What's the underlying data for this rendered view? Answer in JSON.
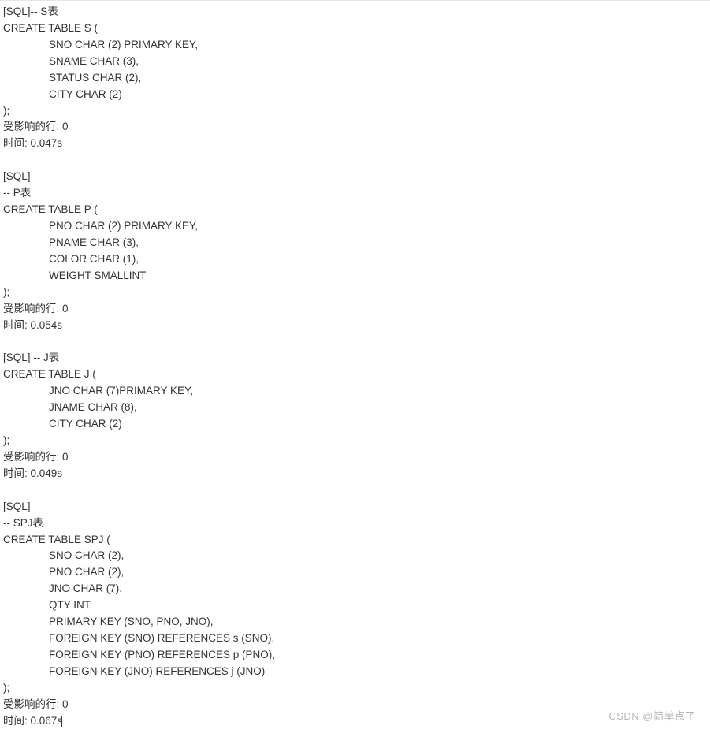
{
  "blocks": [
    {
      "header": "[SQL]-- S表",
      "create": "CREATE TABLE S (",
      "cols": [
        "SNO CHAR (2) PRIMARY KEY,",
        "SNAME CHAR (3),",
        "STATUS CHAR (2),",
        "CITY CHAR (2)"
      ],
      "close": ");",
      "affected": "受影响的行: 0",
      "time": "时间: 0.047s"
    },
    {
      "header": "[SQL]",
      "comment": "-- P表",
      "create": "CREATE TABLE P (",
      "cols": [
        "PNO CHAR (2) PRIMARY KEY,",
        "PNAME CHAR (3),",
        "COLOR CHAR (1),",
        "WEIGHT SMALLINT"
      ],
      "close": ");",
      "affected": "受影响的行: 0",
      "time": "时间: 0.054s"
    },
    {
      "header": "[SQL] -- J表",
      "create": "CREATE TABLE J (",
      "cols": [
        "JNO CHAR (7)PRIMARY KEY,",
        "JNAME CHAR (8),",
        "CITY CHAR (2)"
      ],
      "close": ");",
      "affected": "受影响的行: 0",
      "time": "时间: 0.049s"
    },
    {
      "header": "[SQL]",
      "comment": "-- SPJ表",
      "create": "CREATE TABLE SPJ (",
      "cols": [
        "SNO CHAR (2),",
        "PNO CHAR (2),",
        "JNO CHAR (7),",
        "QTY INT,",
        "PRIMARY KEY (SNO, PNO, JNO),",
        "FOREIGN KEY (SNO) REFERENCES s (SNO),",
        "FOREIGN KEY (PNO) REFERENCES p (PNO),",
        "FOREIGN KEY (JNO) REFERENCES j (JNO)"
      ],
      "close": ");",
      "affected": "受影响的行: 0",
      "time": "时间: 0.067s",
      "cursor": true
    }
  ],
  "watermark": "CSDN @简单点了"
}
